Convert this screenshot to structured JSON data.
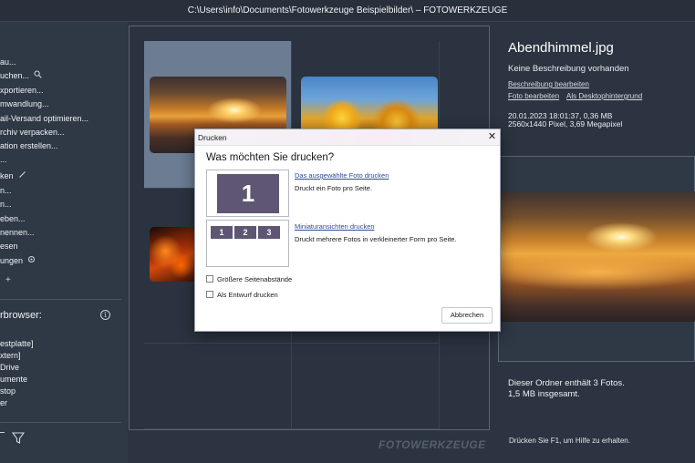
{
  "window": {
    "title": "C:\\Users\\info\\Documents\\Fotowerkzeuge Beispielbilder\\ – FOTOWERKZEUGE"
  },
  "sidebar": {
    "menu_items": [
      {
        "label": "au..."
      },
      {
        "label": "uchen...",
        "icon": "search-icon"
      },
      {
        "label": "xportieren..."
      },
      {
        "label": "mwandlung..."
      },
      {
        "label": "ail-Versand optimieren..."
      },
      {
        "label": "rchiv verpacken..."
      },
      {
        "label": "ation erstellen..."
      },
      {
        "label": "..."
      },
      {
        "label": "ken",
        "icon": "pencil-icon"
      },
      {
        "label": "n..."
      },
      {
        "label": "n..."
      },
      {
        "label": "eben..."
      },
      {
        "label": "nennen..."
      },
      {
        "label": "esen"
      },
      {
        "label": "ungen",
        "icon": "gear-icon"
      },
      {
        "label": "",
        "icon": "plus-icon"
      }
    ],
    "browser_header": "rbrowser:",
    "folders": [
      {
        "label": "estplatte]"
      },
      {
        "label": "xtern]"
      },
      {
        "label": "Drive"
      },
      {
        "label": "umente"
      },
      {
        "label": "stop"
      },
      {
        "label": "er"
      }
    ]
  },
  "gallery": {
    "watermark": "FOTOWERKZEUGE",
    "thumbnails": [
      {
        "name": "sunset-sky",
        "selected": true
      },
      {
        "name": "autumn-tree",
        "selected": false
      },
      {
        "name": "fire",
        "selected": false
      }
    ]
  },
  "info_panel": {
    "filename": "Abendhimmel.jpg",
    "description": "Keine Beschreibung vorhanden",
    "edit_description_link": "Beschreibung bearbeiten",
    "edit_photo_link": "Foto bearbeiten",
    "desktop_bg_link": "Als Desktophintergrund",
    "date_size": "20.01.2023 18:01:37, 0,36 MB",
    "dimensions": "2560x1440 Pixel, 3,69 Megapixel",
    "folder_count": "Dieser Ordner enthält 3 Fotos.",
    "folder_total": "1,5 MB insgesamt.",
    "help": "Drücken Sie F1, um Hilfe zu erhalten."
  },
  "dialog": {
    "title": "Drucken",
    "heading": "Was möchten Sie drucken?",
    "option1": {
      "preview_number": "1",
      "link": "Das ausgewählte Foto drucken",
      "description": "Druckt ein Foto pro Seite."
    },
    "option2": {
      "preview_numbers": [
        "1",
        "2",
        "3"
      ],
      "link": "Miniaturansichten drucken",
      "description": "Druckt mehrere Fotos in verkleinerter Form pro Seite."
    },
    "checkbox_margins": {
      "label": "Größere Seitenabstände",
      "checked": false
    },
    "checkbox_draft": {
      "label": "Als Entwurf drucken",
      "checked": false
    },
    "cancel_button": "Abbrechen"
  }
}
